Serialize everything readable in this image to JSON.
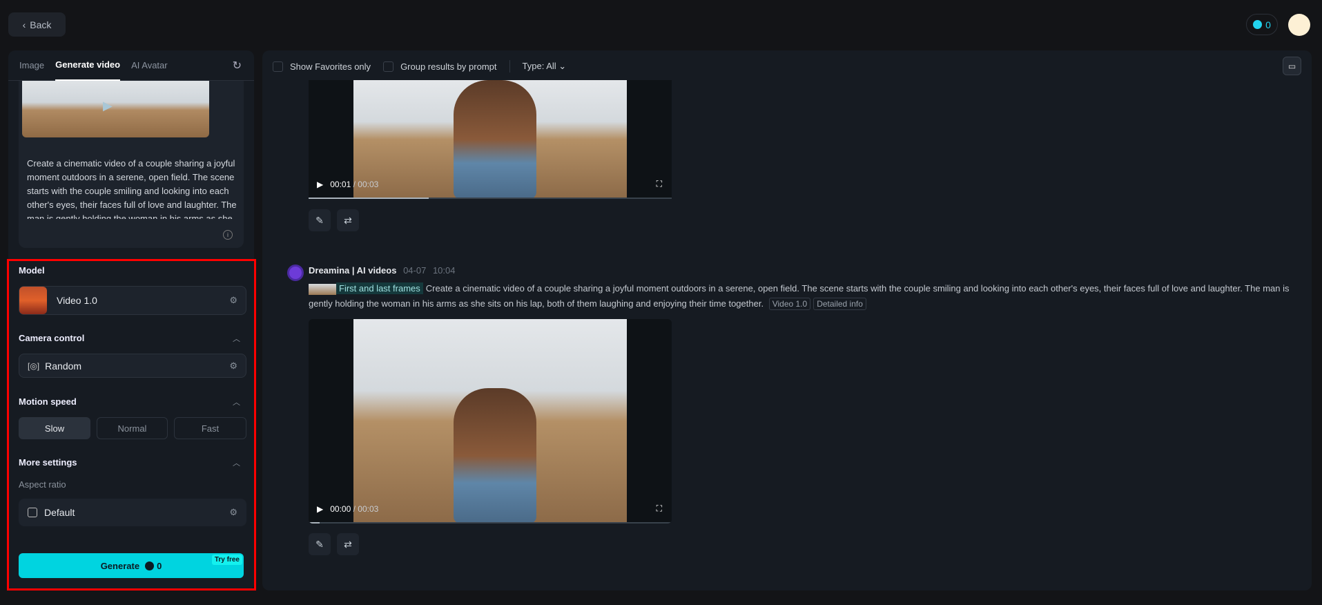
{
  "header": {
    "back_label": "Back",
    "credits": "0"
  },
  "tabs": [
    {
      "label": "Image"
    },
    {
      "label": "Generate video"
    },
    {
      "label": "AI Avatar"
    }
  ],
  "prompt": {
    "text": "Create a cinematic video of a couple sharing a joyful moment outdoors in a serene, open field. The scene starts with the couple smiling and looking into each other's eyes, their faces full of love and laughter. The man is gently holding the woman in his arms as she sits on his lap, both of them laughing and enjoying their time together."
  },
  "settings": {
    "model_label": "Model",
    "model_value": "Video 1.0",
    "camera_label": "Camera control",
    "camera_value": "Random",
    "motion_label": "Motion speed",
    "motion_options": [
      "Slow",
      "Normal",
      "Fast"
    ],
    "motion_selected": "Slow",
    "more_label": "More settings",
    "aspect_label": "Aspect ratio",
    "aspect_value": "Default",
    "generate_label": "Generate",
    "generate_cost": "0",
    "try_free": "Try free"
  },
  "filters": {
    "favorites": "Show Favorites only",
    "group": "Group results by prompt",
    "type": "Type: All"
  },
  "results": [
    {
      "time": "00:01",
      "duration": "00:03",
      "progress": 0.33
    },
    {
      "author": "Dreamina | AI videos",
      "date": "04-07",
      "clock": "10:04",
      "frames_label": "First and last frames",
      "prompt": "Create a cinematic video of a couple sharing a joyful moment outdoors in a serene, open field. The scene starts with the couple smiling and looking into each other's eyes, their faces full of love and laughter. The man is gently holding the woman in his arms as she sits on his lap, both of them laughing and enjoying their time together.",
      "model_tag": "Video 1.0",
      "detail_tag": "Detailed info",
      "time": "00:00",
      "duration": "00:03",
      "progress": 0.03
    }
  ]
}
